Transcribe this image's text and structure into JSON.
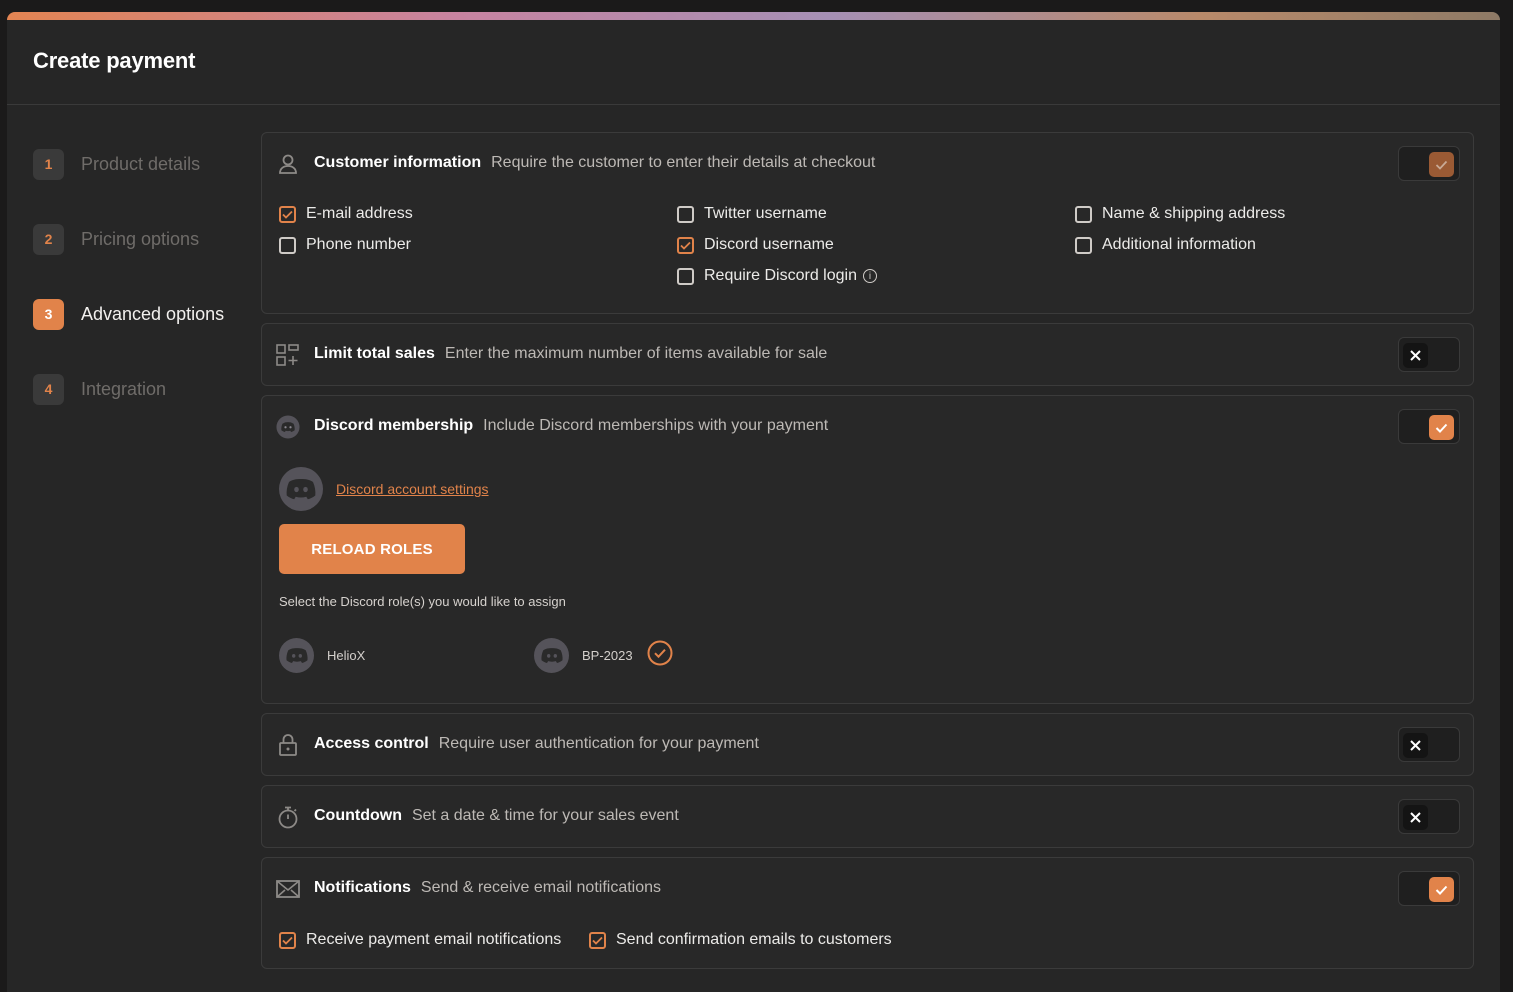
{
  "header": {
    "title": "Create payment"
  },
  "steps": [
    {
      "num": "1",
      "label": "Product details"
    },
    {
      "num": "2",
      "label": "Pricing options"
    },
    {
      "num": "3",
      "label": "Advanced options"
    },
    {
      "num": "4",
      "label": "Integration"
    }
  ],
  "customer_info": {
    "title": "Customer information",
    "desc": "Require the customer to enter their details at checkout",
    "enabled": true,
    "options": {
      "email": "E-mail address",
      "phone": "Phone number",
      "twitter": "Twitter username",
      "discord": "Discord username",
      "discord_login": "Require Discord login",
      "shipping": "Name & shipping address",
      "additional": "Additional information"
    }
  },
  "limit_sales": {
    "title": "Limit total sales",
    "desc": "Enter the maximum number of items available for sale",
    "enabled": false
  },
  "discord_membership": {
    "title": "Discord membership",
    "desc": "Include Discord memberships with your payment",
    "enabled": true,
    "settings_link": "Discord account settings",
    "reload_label": "RELOAD ROLES",
    "roles_label": "Select the Discord role(s) you would like to assign",
    "roles": [
      {
        "name": "HelioX",
        "selected": false
      },
      {
        "name": "BP-2023",
        "selected": true
      }
    ]
  },
  "access_control": {
    "title": "Access control",
    "desc": "Require user authentication for your payment",
    "enabled": false
  },
  "countdown": {
    "title": "Countdown",
    "desc": "Set a date & time for your sales event",
    "enabled": false
  },
  "notifications": {
    "title": "Notifications",
    "desc": "Send & receive email notifications",
    "enabled": true,
    "options": {
      "receive": "Receive payment email notifications",
      "send": "Send confirmation emails to customers"
    }
  },
  "colors": {
    "accent": "#e1834a",
    "panel": "#262626",
    "card": "#282828"
  }
}
